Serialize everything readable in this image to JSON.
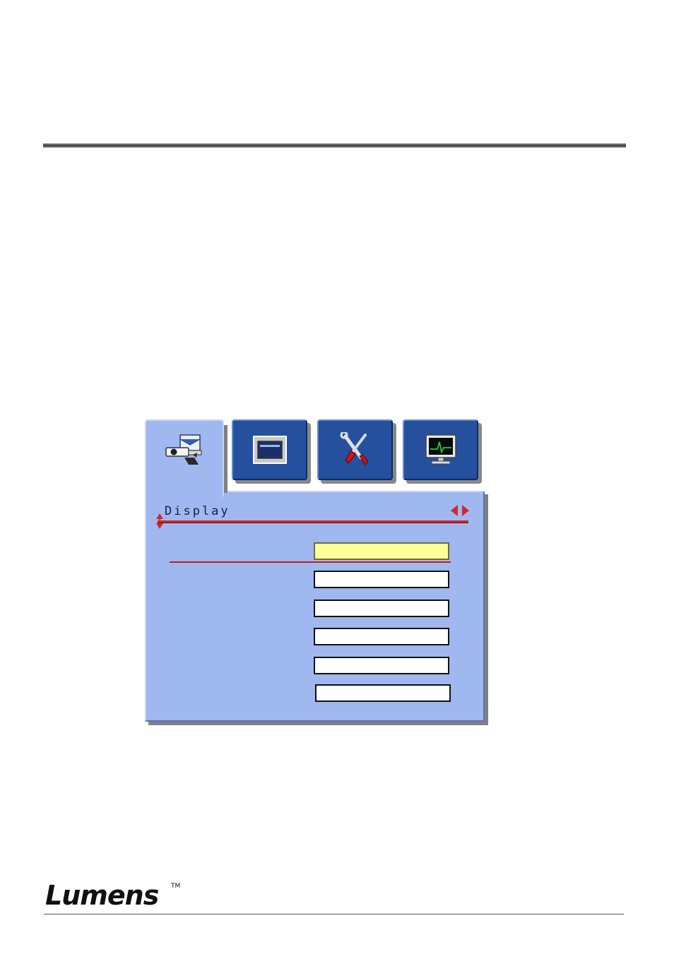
{
  "osd": {
    "tabs": [
      {
        "icon": "source-projector-icon",
        "active": true
      },
      {
        "icon": "image-display-icon",
        "active": false
      },
      {
        "icon": "tools-icon",
        "active": false
      },
      {
        "icon": "monitor-status-icon",
        "active": false
      }
    ],
    "panel_title": "Display",
    "fields": [
      {
        "value": "",
        "selected": true
      },
      {
        "value": "",
        "selected": false
      },
      {
        "value": "",
        "selected": false
      },
      {
        "value": "",
        "selected": false
      },
      {
        "value": "",
        "selected": false
      },
      {
        "value": "",
        "selected": false
      }
    ]
  },
  "footer": {
    "brand": "Lumens",
    "trademark": "TM"
  },
  "colors": {
    "panel": "#a0b8f0",
    "tab": "#24509e",
    "accent_line": "#d0282a",
    "selected_field": "#ffff99"
  }
}
